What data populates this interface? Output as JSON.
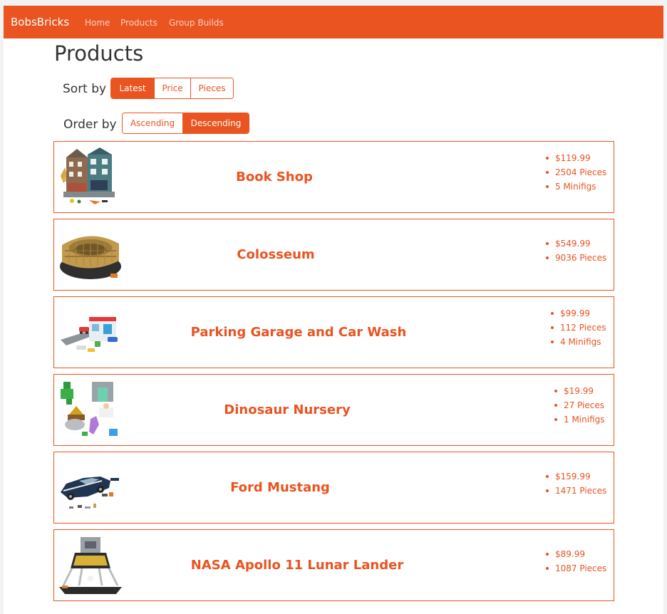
{
  "navbar": {
    "brand": "BobsBricks",
    "links": [
      "Home",
      "Products",
      "Group Builds"
    ]
  },
  "page_title": "Products",
  "sort": {
    "label": "Sort by",
    "options": [
      "Latest",
      "Price",
      "Pieces"
    ],
    "selected": "Latest"
  },
  "order": {
    "label": "Order by",
    "options": [
      "Ascending",
      "Descending"
    ],
    "selected": "Descending"
  },
  "products": [
    {
      "name": "Book Shop",
      "price": "$119.99",
      "pieces": "2504 Pieces",
      "minifigs": "5 Minifigs",
      "image": "book-shop-set-image"
    },
    {
      "name": "Colosseum",
      "price": "$549.99",
      "pieces": "9036 Pieces",
      "image": "colosseum-set-image"
    },
    {
      "name": "Parking Garage and Car Wash",
      "price": "$99.99",
      "pieces": "112 Pieces",
      "minifigs": "4 Minifigs",
      "image": "parking-garage-set-image"
    },
    {
      "name": "Dinosaur Nursery",
      "price": "$19.99",
      "pieces": "27 Pieces",
      "minifigs": "1 Minifigs",
      "image": "dinosaur-nursery-set-image"
    },
    {
      "name": "Ford Mustang",
      "price": "$159.99",
      "pieces": "1471 Pieces",
      "image": "ford-mustang-set-image"
    },
    {
      "name": "NASA Apollo 11 Lunar Lander",
      "price": "$89.99",
      "pieces": "1087 Pieces",
      "image": "lunar-lander-set-image"
    }
  ],
  "colors": {
    "accent": "#e95420",
    "text": "#333333",
    "background": "#ffffff"
  }
}
